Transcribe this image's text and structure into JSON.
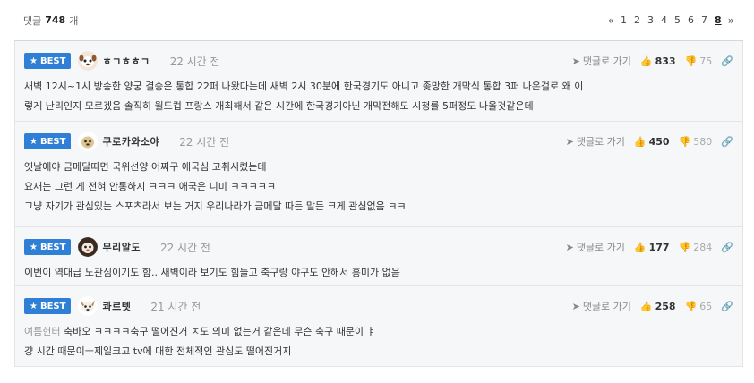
{
  "header": {
    "count_prefix": "댓글",
    "count_value": "748",
    "count_suffix": "개",
    "pager": {
      "first": "«",
      "pages": [
        "1",
        "2",
        "3",
        "4",
        "5",
        "6",
        "7",
        "8"
      ],
      "active": "8",
      "next": "»"
    }
  },
  "actions": {
    "reply_label": "댓글로 가기"
  },
  "comments": [
    {
      "badge": "BEST",
      "nickname": "ㅎㄱㅎㅎㄱ",
      "time": "22 시간 전",
      "likes": "833",
      "dislikes": "75",
      "lines": [
        "새벽 12시~1시 방송한 양궁 결승은 통합 22퍼 나왔다는데 새벽 2시 30분에 한국경기도 아니고 좆망한 개막식 통합 3퍼 나온걸로 왜 이",
        "렇게 난리인지 모르겠음 솔직히 월드컵 프랑스 개최해서 같은 시간에 한국경기아닌 개막전해도 시청률 5퍼정도 나올것같은데"
      ]
    },
    {
      "badge": "BEST",
      "nickname": "쿠로카와소야",
      "time": "22 시간 전",
      "likes": "450",
      "dislikes": "580",
      "lines": [
        "옛날에야 금메달따면 국위선양 어쩌구 애국심 고취시켰는데",
        "요새는 그런 게 전혀 안통하지 ㅋㅋㅋ 애국은 니미 ㅋㅋㅋㅋㅋ",
        "그냥 자기가 관심있는 스포츠라서 보는 거지 우리나라가 금메달 따든 말든 크게 관심없음 ㅋㅋ"
      ]
    },
    {
      "badge": "BEST",
      "nickname": "무리알도",
      "time": "22 시간 전",
      "likes": "177",
      "dislikes": "284",
      "lines": [
        "이번이 역대급 노관심이기도 함.. 새벽이라 보기도 힘들고 축구랑 야구도 안해서 흥미가 없음"
      ]
    },
    {
      "badge": "BEST",
      "nickname": "콰르텟",
      "time": "21 시간 전",
      "likes": "258",
      "dislikes": "65",
      "reply_to": "여름헌터",
      "lines": [
        "축바오 ㅋㅋㅋㅋ축구 떨어진거 ㅈ도 의미 없는거 같은데 무슨 축구 때문이 ㅑ",
        "걍 시간 때문이ㅡ제일크고 tv에 대한 전체적인 관심도 떨어진거지"
      ]
    }
  ]
}
